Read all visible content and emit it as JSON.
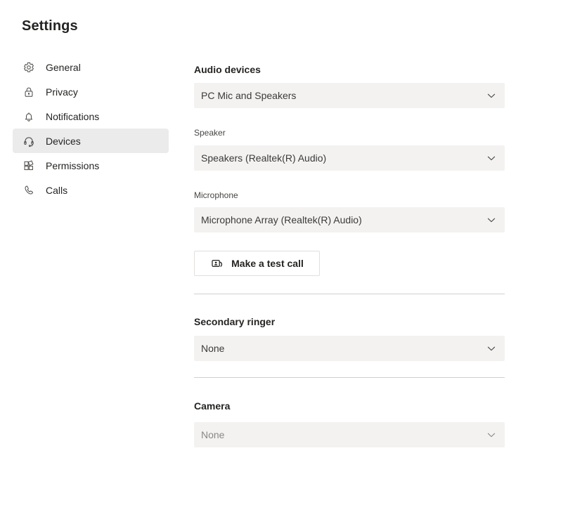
{
  "page": {
    "title": "Settings"
  },
  "sidebar": {
    "items": [
      {
        "label": "General",
        "icon": "gear-icon",
        "selected": false
      },
      {
        "label": "Privacy",
        "icon": "lock-icon",
        "selected": false
      },
      {
        "label": "Notifications",
        "icon": "bell-icon",
        "selected": false
      },
      {
        "label": "Devices",
        "icon": "headset-icon",
        "selected": true
      },
      {
        "label": "Permissions",
        "icon": "app-grid-icon",
        "selected": false
      },
      {
        "label": "Calls",
        "icon": "phone-icon",
        "selected": false
      }
    ]
  },
  "main": {
    "audio_devices": {
      "heading": "Audio devices",
      "selected": "PC Mic and Speakers"
    },
    "speaker": {
      "label": "Speaker",
      "selected": "Speakers (Realtek(R) Audio)"
    },
    "microphone": {
      "label": "Microphone",
      "selected": "Microphone Array (Realtek(R) Audio)"
    },
    "test_call": {
      "label": "Make a test call",
      "icon": "meet-now-icon"
    },
    "secondary_ringer": {
      "heading": "Secondary ringer",
      "selected": "None"
    },
    "camera": {
      "heading": "Camera",
      "selected": "None"
    }
  },
  "colors": {
    "selected_nav_bg": "#ebebeb",
    "field_bg": "#f3f2f1",
    "divider": "#d2d0ce",
    "text_primary": "#252423",
    "text_secondary": "#484644",
    "text_muted": "#8a8886"
  }
}
